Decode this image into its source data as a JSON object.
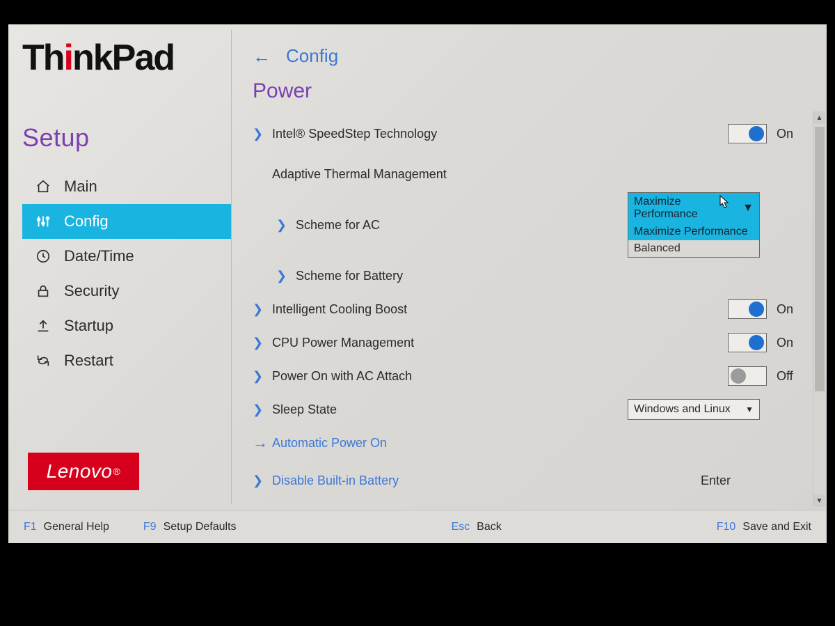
{
  "brand": {
    "logo_a": "Th",
    "logo_b": "nkPad",
    "lenovo": "Lenovo"
  },
  "sidebar": {
    "title": "Setup",
    "items": [
      {
        "icon": "home-icon",
        "label": "Main"
      },
      {
        "icon": "sliders-icon",
        "label": "Config"
      },
      {
        "icon": "clock-icon",
        "label": "Date/Time"
      },
      {
        "icon": "lock-icon",
        "label": "Security"
      },
      {
        "icon": "upload-icon",
        "label": "Startup"
      },
      {
        "icon": "restart-icon",
        "label": "Restart"
      }
    ]
  },
  "header": {
    "breadcrumb": "Config",
    "title": "Power"
  },
  "toggle_labels": {
    "on": "On",
    "off": "Off"
  },
  "rows": {
    "speedstep": {
      "label": "Intel® SpeedStep Technology",
      "value": "On"
    },
    "thermal_head": {
      "label": "Adaptive Thermal Management"
    },
    "scheme_ac": {
      "label": "Scheme for AC",
      "selected": "Maximize Performance",
      "options": [
        "Maximize Performance",
        "Balanced"
      ]
    },
    "scheme_batt": {
      "label": "Scheme for Battery"
    },
    "cooling": {
      "label": "Intelligent Cooling Boost",
      "value": "On"
    },
    "cpu_pm": {
      "label": "CPU Power Management",
      "value": "On"
    },
    "ac_attach": {
      "label": "Power On with AC Attach",
      "value": "Off"
    },
    "sleep": {
      "label": "Sleep State",
      "selected": "Windows and Linux"
    },
    "auto_power": {
      "label": "Automatic Power On"
    },
    "disable_batt": {
      "label": "Disable Built-in Battery",
      "value": "Enter"
    }
  },
  "footer": {
    "f1": {
      "key": "F1",
      "label": "General Help"
    },
    "f9": {
      "key": "F9",
      "label": "Setup Defaults"
    },
    "esc": {
      "key": "Esc",
      "label": "Back"
    },
    "f10": {
      "key": "F10",
      "label": "Save and Exit"
    }
  }
}
